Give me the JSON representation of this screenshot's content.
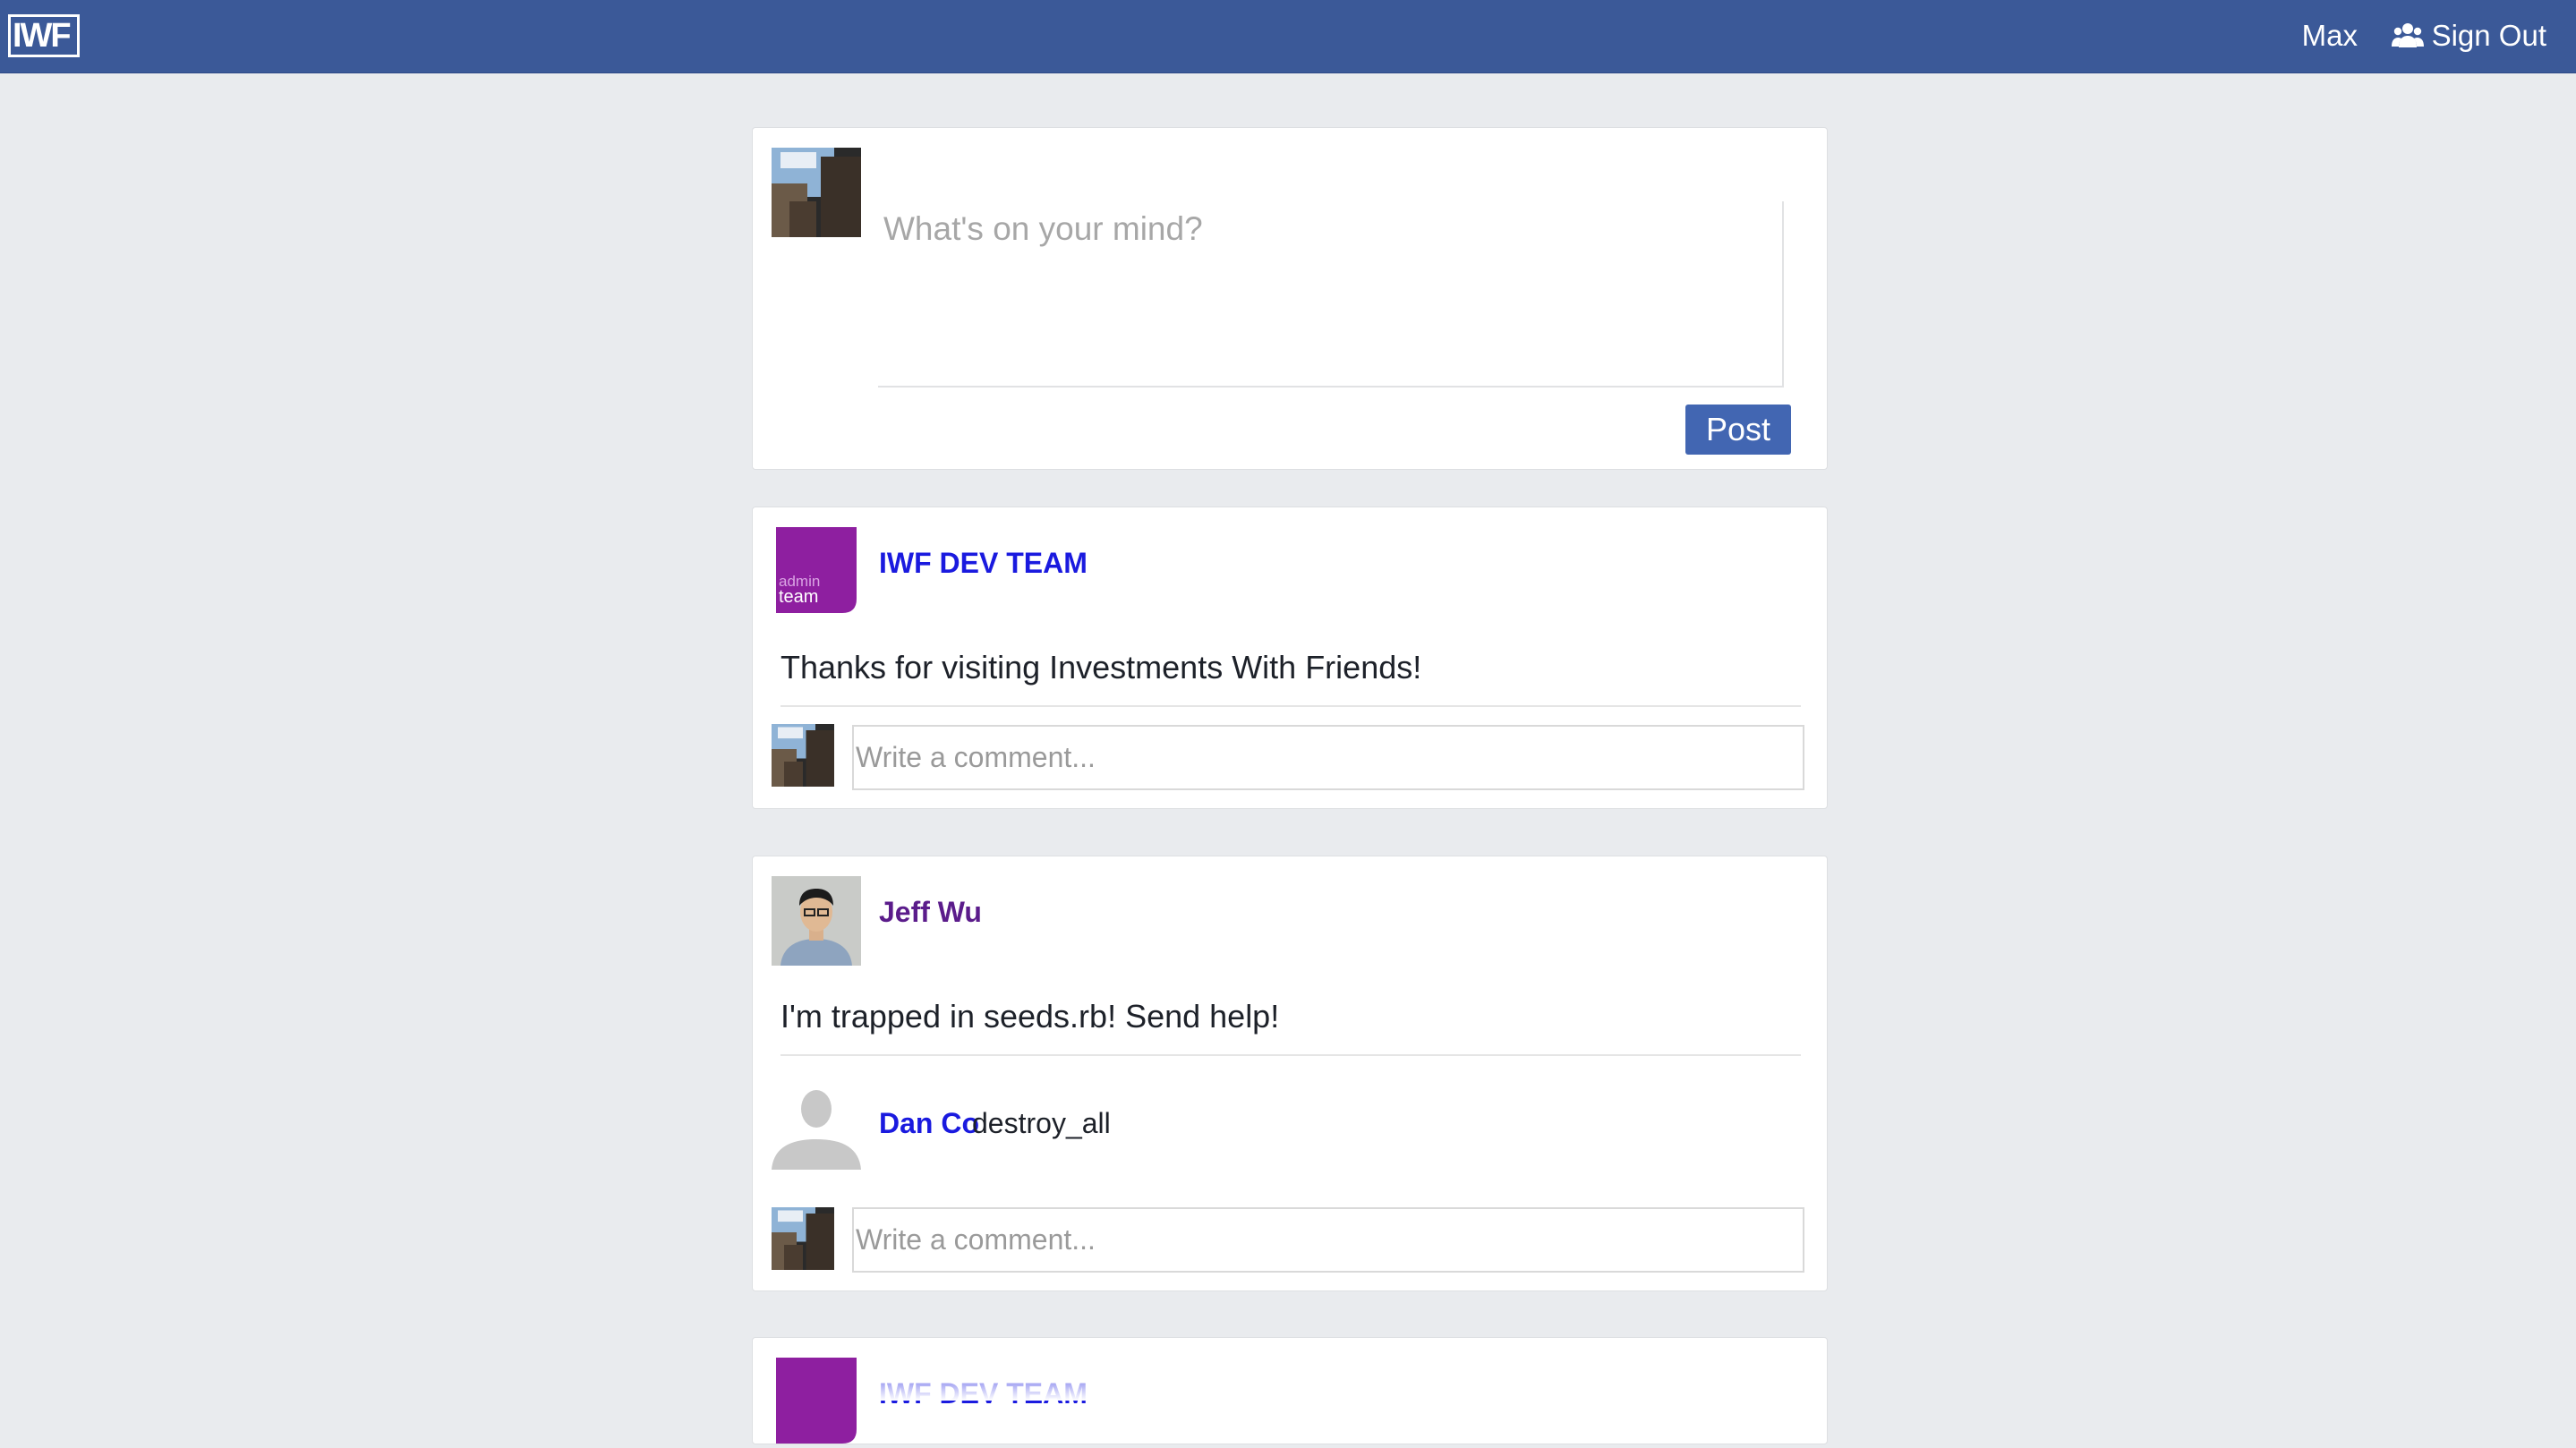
{
  "header": {
    "logo_text": "IWF",
    "user_name": "Max",
    "friends_icon": "users-icon",
    "sign_out_label": "Sign Out",
    "bar_color": "#3b5998"
  },
  "composer": {
    "placeholder": "What's on your mind?",
    "post_label": "Post",
    "post_button_color": "#4266b2"
  },
  "posts": [
    {
      "author": "IWF DEV TEAM",
      "avatar": "admin-team-avatar",
      "avatar_text_top": "admin",
      "avatar_text_bottom": "team",
      "body": "Thanks for visiting Investments With Friends!",
      "comments": [],
      "comment_placeholder": "Write a comment..."
    },
    {
      "author": "Jeff Wu",
      "avatar": "user-photo-avatar",
      "body": "I'm trapped in seeds.rb! Send help!",
      "comments": [
        {
          "author": "Dan Co",
          "text": "destroy_all",
          "avatar": "default-user-silhouette"
        }
      ],
      "comment_placeholder": "Write a comment..."
    },
    {
      "author": "IWF DEV TEAM",
      "avatar": "admin-team-avatar"
    }
  ]
}
